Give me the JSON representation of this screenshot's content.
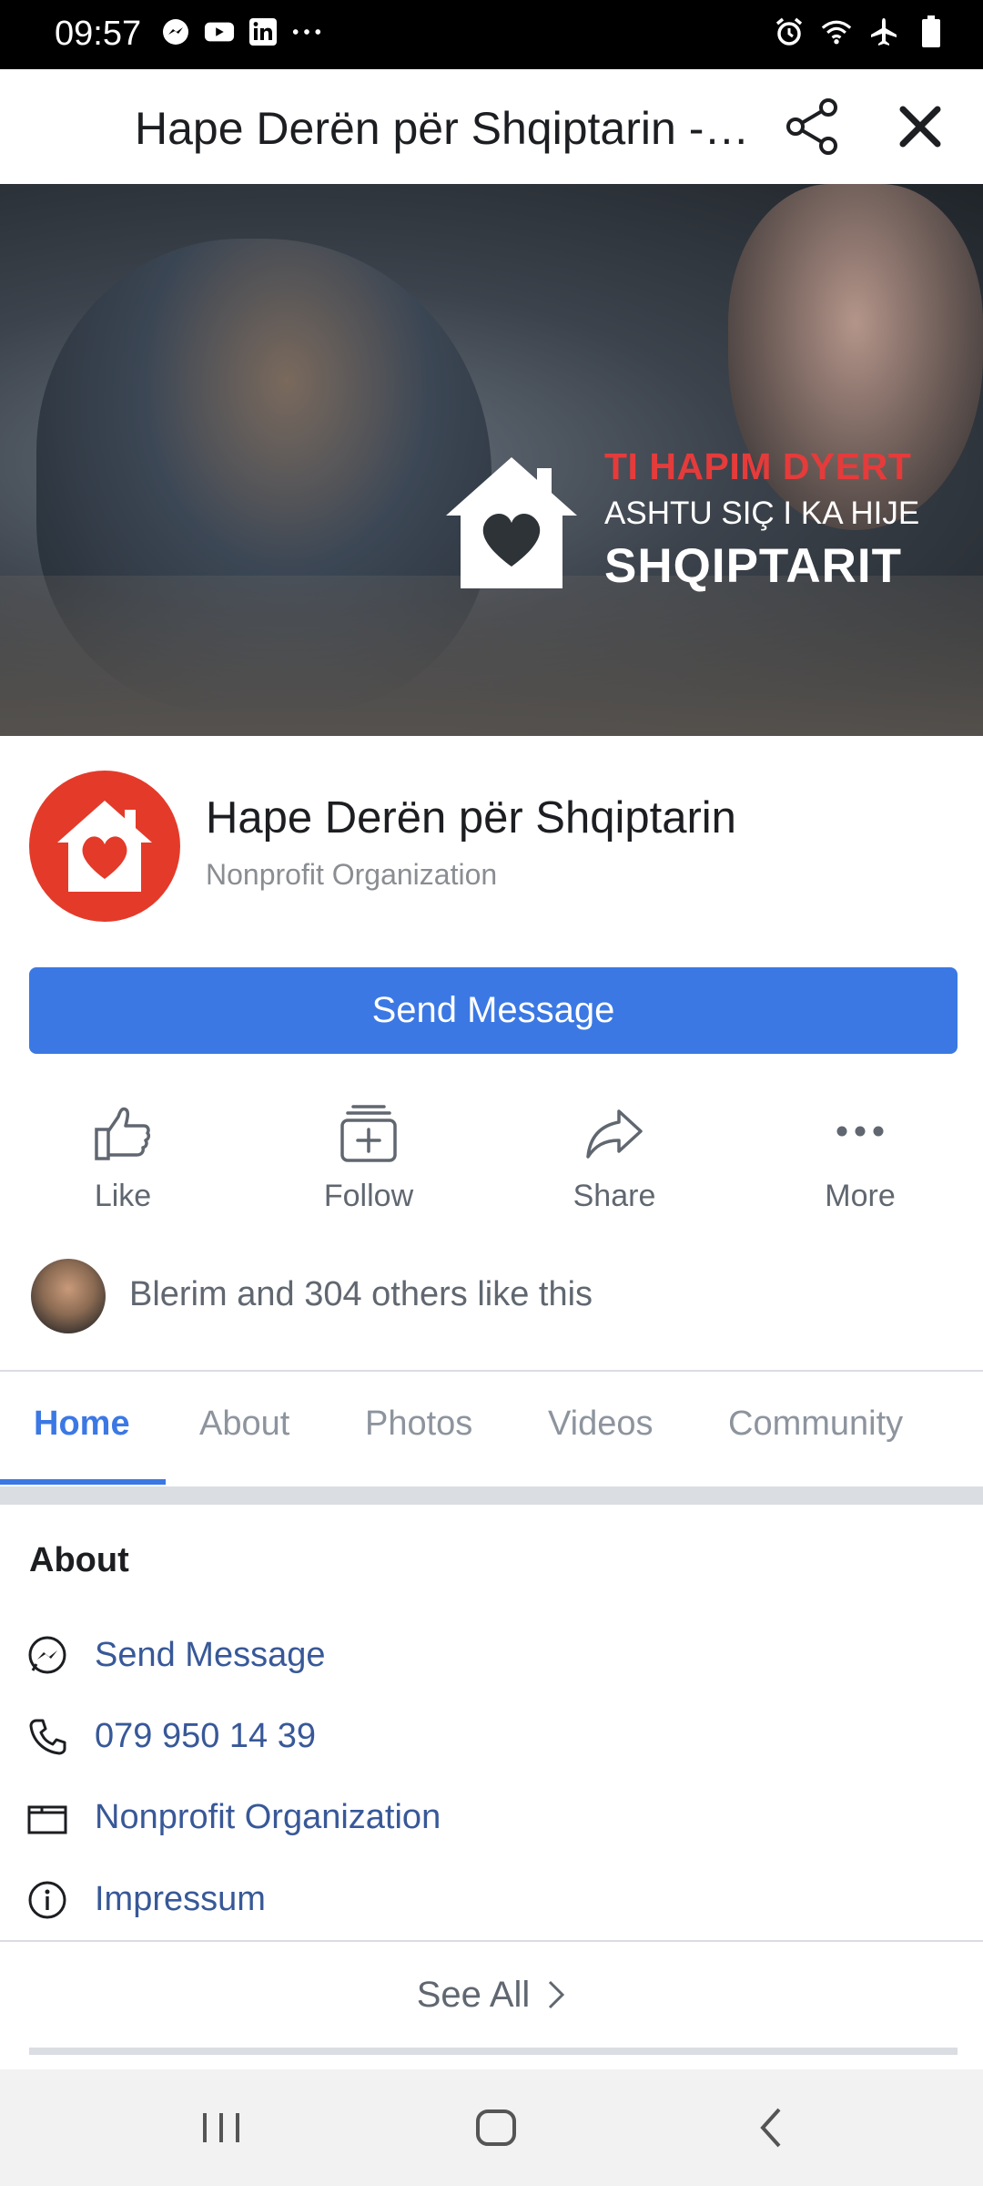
{
  "status_bar": {
    "time": "09:57",
    "left_icons": [
      "messenger-icon",
      "youtube-icon",
      "linkedin-icon",
      "more-dots-icon"
    ],
    "right_icons": [
      "alarm-icon",
      "wifi-icon",
      "airplane-icon",
      "battery-icon"
    ]
  },
  "header": {
    "title": "Hape Derën për Shqiptarin - Home | Facebook",
    "share_icon": "share-icon",
    "close_icon": "close-icon"
  },
  "cover": {
    "line1": "TI HAPIM DYERT",
    "line2": "ASHTU SIÇ I KA HIJE",
    "line3": "SHQIPTARIT"
  },
  "profile": {
    "name": "Hape Derën për Shqiptarin",
    "category": "Nonprofit Organization"
  },
  "send_message_button": "Send Message",
  "actions": [
    {
      "label": "Like",
      "icon": "thumbs-up-icon"
    },
    {
      "label": "Follow",
      "icon": "follow-icon"
    },
    {
      "label": "Share",
      "icon": "share-arrow-icon"
    },
    {
      "label": "More",
      "icon": "more-icon"
    }
  ],
  "likes": {
    "text": "Blerim and 304 others like this"
  },
  "tabs": [
    {
      "label": "Home",
      "active": true
    },
    {
      "label": "About",
      "active": false
    },
    {
      "label": "Photos",
      "active": false
    },
    {
      "label": "Videos",
      "active": false
    },
    {
      "label": "Community",
      "active": false
    }
  ],
  "about": {
    "title": "About",
    "rows": [
      {
        "label": "Send Message",
        "icon": "messenger-icon"
      },
      {
        "label": "079 950 14 39",
        "icon": "phone-icon"
      },
      {
        "label": "Nonprofit Organization",
        "icon": "category-icon"
      },
      {
        "label": "Impressum",
        "icon": "info-icon"
      }
    ],
    "see_all": "See All"
  },
  "colors": {
    "accent": "#3b78e4",
    "link": "#385898",
    "brand_red": "#e43a2a"
  }
}
